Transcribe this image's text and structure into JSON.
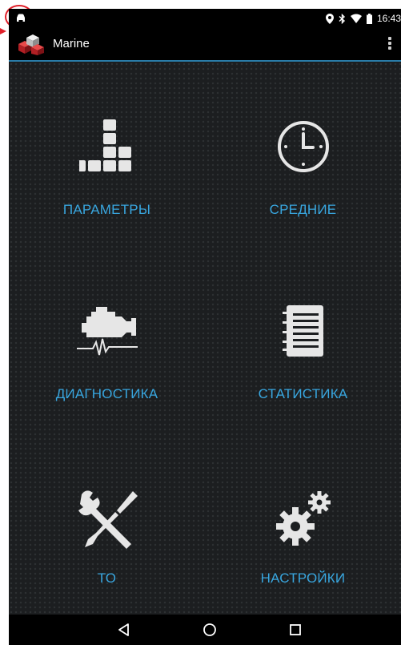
{
  "status_bar": {
    "time": "16:43",
    "icons": [
      "car-notification-icon",
      "location-icon",
      "bluetooth-icon",
      "wifi-icon",
      "battery-icon"
    ]
  },
  "action_bar": {
    "title": "Marine",
    "logo_icon": "app-logo-cubes-icon",
    "menu_icon": "overflow-menu-icon"
  },
  "menu": {
    "tiles": [
      {
        "label": "ПАРАМЕТРЫ",
        "icon": "parameters-blocks-icon"
      },
      {
        "label": "СРЕДНИЕ",
        "icon": "clock-icon"
      },
      {
        "label": "ДИАГНОСТИКА",
        "icon": "engine-diagnostics-icon"
      },
      {
        "label": "СТАТИСТИКА",
        "icon": "notebook-icon"
      },
      {
        "label": "ТО",
        "icon": "wrench-screwdriver-icon"
      },
      {
        "label": "НАСТРОЙКИ",
        "icon": "gears-icon"
      }
    ]
  },
  "colors": {
    "accent": "#38a6df",
    "background": "#1c1e20",
    "bars": "#000000",
    "icon": "#ffffff"
  },
  "nav_bar": {
    "buttons": [
      "back-icon",
      "home-icon",
      "recents-icon"
    ]
  }
}
